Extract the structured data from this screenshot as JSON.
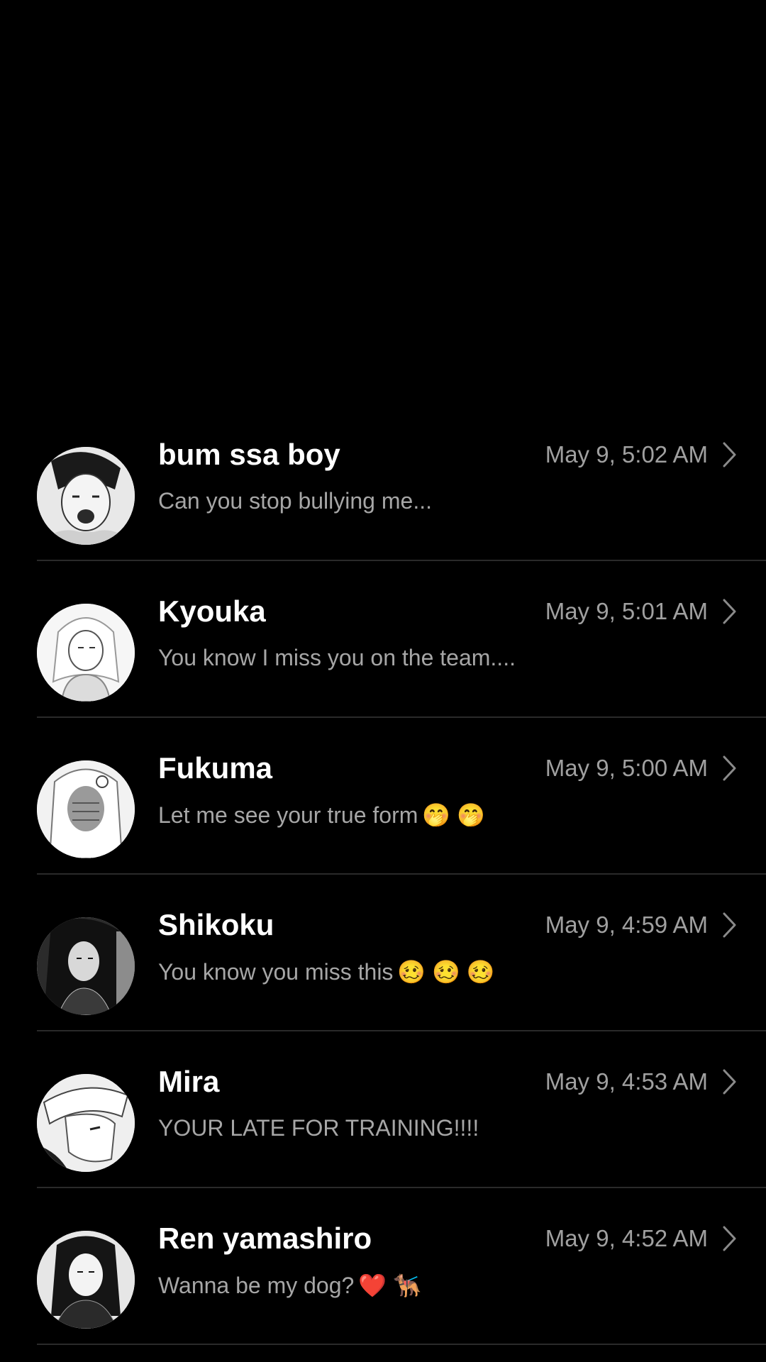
{
  "conversations": [
    {
      "name": "bum ssa boy",
      "time": "May 9, 5:02 AM",
      "preview": "Can you stop bullying me...",
      "emojis": ""
    },
    {
      "name": "Kyouka",
      "time": "May 9, 5:01 AM",
      "preview": "You know I miss you on the team....",
      "emojis": ""
    },
    {
      "name": "Fukuma",
      "time": "May 9, 5:00 AM",
      "preview": "Let me see your true form",
      "emojis": "🤭 🤭"
    },
    {
      "name": "Shikoku",
      "time": "May 9, 4:59 AM",
      "preview": "You know you miss this",
      "emojis": "🥴 🥴 🥴"
    },
    {
      "name": "Mira",
      "time": "May 9, 4:53 AM",
      "preview": "YOUR LATE FOR TRAINING!!!!",
      "emojis": ""
    },
    {
      "name": "Ren yamashiro",
      "time": "May 9, 4:52 AM",
      "preview": "Wanna be my dog?",
      "emojis": "❤️ 🐕‍🦺"
    }
  ],
  "icons": {
    "avatar": "avatar-image",
    "chevron": "chevron-right-icon"
  },
  "colors": {
    "background": "#000000",
    "name": "#ffffff",
    "secondary_text": "#a6a6a6",
    "divider": "#2a2a2a"
  }
}
